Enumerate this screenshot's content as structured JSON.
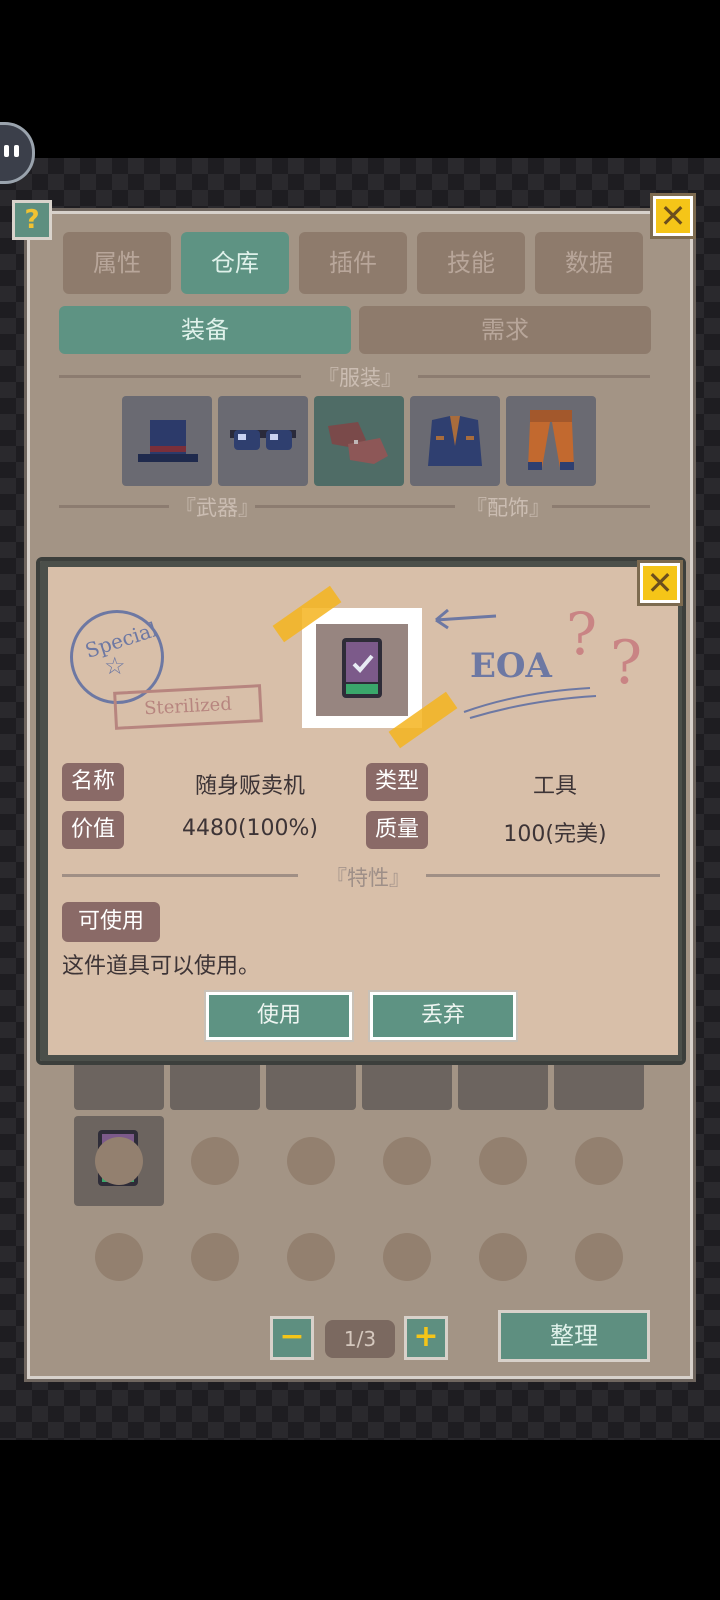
{
  "tabs": [
    "属性",
    "仓库",
    "插件",
    "技能",
    "数据"
  ],
  "active_tab_index": 1,
  "subtabs": [
    "装备",
    "需求"
  ],
  "active_subtab_index": 0,
  "sections": {
    "clothing": "『服装』",
    "weapons": "『武器』",
    "accessories": "『配饰』"
  },
  "icons": {
    "help": "?",
    "close": "✕",
    "minus": "−",
    "plus": "+"
  },
  "pager": {
    "indicator": "1/3"
  },
  "sort_label": "整理",
  "popup": {
    "stamp_round": "Special",
    "stamp_rect": "Sterilized",
    "scribble": "EOA",
    "fields": {
      "name_label": "名称",
      "name_value": "随身贩卖机",
      "type_label": "类型",
      "type_value": "工具",
      "value_label": "价值",
      "value_value": "4480(100%)",
      "quality_label": "质量",
      "quality_value": "100(完美)"
    },
    "traits_header": "『特性』",
    "trait_chip": "可使用",
    "trait_desc": "这件道具可以使用。",
    "use_button": "使用",
    "discard_button": "丢弃"
  },
  "colors": {
    "teal": "#5e9383",
    "panel": "#a39485",
    "popup_paper": "#d8bfa9",
    "accent_yellow": "#f5c518"
  }
}
